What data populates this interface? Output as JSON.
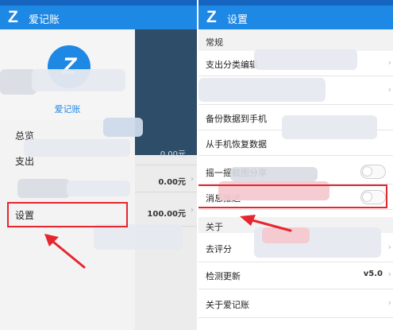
{
  "colors": {
    "primary": "#1e88e5",
    "statusbar": "#1565c0",
    "highlight": "#e5262f"
  },
  "left": {
    "appbar": {
      "logo": "Z",
      "title": "爱记账"
    },
    "drawer": {
      "avatar_logo": "Z",
      "app_name": "爱记账",
      "items": [
        {
          "label": "总览"
        },
        {
          "label": "支出"
        },
        {
          "label": "设置"
        }
      ]
    },
    "background": {
      "amounts": [
        "0.00元",
        "0.00元",
        "100.00元"
      ]
    }
  },
  "right": {
    "appbar": {
      "logo": "Z",
      "title": "设置"
    },
    "section_general": "常规",
    "rows": {
      "category_edit": "支出分类编辑",
      "backup": "备份数据到手机",
      "restore": "从手机恢复数据",
      "shake_share": "摇一摇截图分享",
      "push": "消息推送"
    },
    "section_about": "关于",
    "about_rows": {
      "rate": "去评分",
      "check_update": "检测更新",
      "check_update_value": "v5.0",
      "about_app": "关于爱记账"
    }
  },
  "icons": {
    "chevron": "chevron-right-icon"
  }
}
